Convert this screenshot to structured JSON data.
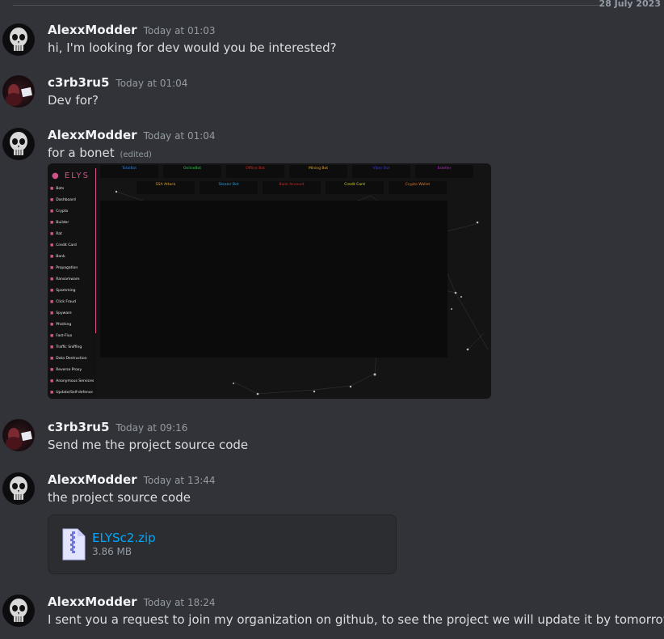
{
  "date_divider": "28 July 2023",
  "users": {
    "alexx": "AlexxModder",
    "c3rb": "c3rb3ru5"
  },
  "messages": [
    {
      "author": "AlexxModder",
      "time": "Today at 01:03",
      "text": "hi, I'm looking for dev would you be interested?"
    },
    {
      "author": "c3rb3ru5",
      "time": "Today at 01:04",
      "text": "Dev for?"
    },
    {
      "author": "AlexxModder",
      "time": "Today at 01:04",
      "text": "for a bonet",
      "edited": "(edited)"
    },
    {
      "author": "c3rb3ru5",
      "time": "Today at 09:16",
      "text": "Send me the project source code"
    },
    {
      "author": "AlexxModder",
      "time": "Today at 13:44",
      "text": "the project source code"
    },
    {
      "author": "AlexxModder",
      "time": "Today at 18:24",
      "text": "I sent you a request to join my organization on github, to see the project we will update it by tomorrow"
    }
  ],
  "attachment": {
    "filename": "ELYSc2.zip",
    "size": "3.86 MB",
    "icon": "zip-file-icon"
  },
  "screenshot": {
    "logo": "ELYS",
    "sidebar": [
      "Bots",
      "Dashboard",
      "Crypto",
      "Builder",
      "Rat",
      "Credit Card",
      "Bank",
      "Propagation",
      "Ransomware",
      "Spamming",
      "Click Fraud",
      "Spyware",
      "Phishing",
      "Fast-Flux",
      "Traffic Sniffing",
      "Data Destruction",
      "Reverse Proxy",
      "Anonymous Services",
      "Update/Self-defense"
    ],
    "sidebar_icons": [
      "user-icon",
      "dashboard-icon",
      "crypto-icon",
      "builder-icon",
      "rat-icon",
      "credit-card-icon",
      "bank-icon",
      "propagation-icon",
      "ransomware-icon",
      "spamming-icon",
      "click-fraud-icon",
      "spyware-icon",
      "phishing-icon",
      "fast-flux-icon",
      "traffic-icon",
      "data-destruction-icon",
      "reverse-proxy-icon",
      "anonymous-icon",
      "update-icon"
    ],
    "top_row": [
      {
        "label": "TotalBot",
        "color": "#2f7fd8"
      },
      {
        "label": "OnlineBot",
        "color": "#2fc84a"
      },
      {
        "label": "Offline Bot",
        "color": "#d02a2a"
      },
      {
        "label": "Mining Bot",
        "color": "#e0a52a"
      },
      {
        "label": "Viber Bot",
        "color": "#3a3ae0"
      },
      {
        "label": "Esteller",
        "color": "#c42ad8"
      }
    ],
    "second_row": [
      {
        "label": "SSA Attack",
        "color": "#e0a52a"
      },
      {
        "label": "Stealer Bot",
        "color": "#2f9fd8"
      },
      {
        "label": "Bank Account",
        "color": "#d02a2a"
      },
      {
        "label": "Credit Card",
        "color": "#d8d82a"
      },
      {
        "label": "Crypto Wallet",
        "color": "#e07a2a"
      }
    ]
  }
}
